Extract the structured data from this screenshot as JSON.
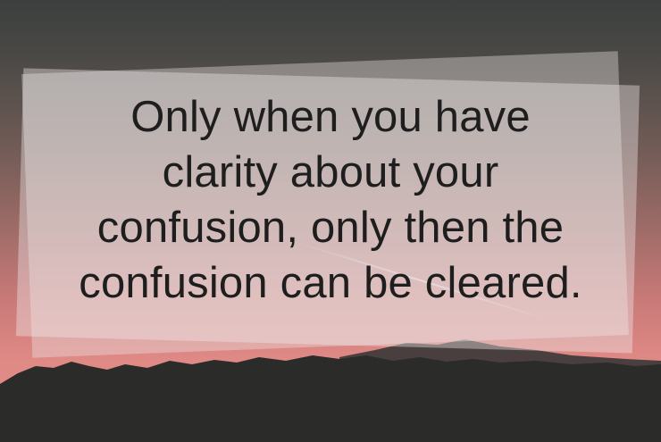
{
  "quote": {
    "lines": [
      "Only when you have",
      "clarity about your",
      "confusion, only then the",
      "confusion can be cleared."
    ]
  },
  "colors": {
    "sky_top": "#3b3f3e",
    "sky_bottom": "#e48d88",
    "mountain": "#2b2b2a",
    "text": "#1e1e1e"
  }
}
